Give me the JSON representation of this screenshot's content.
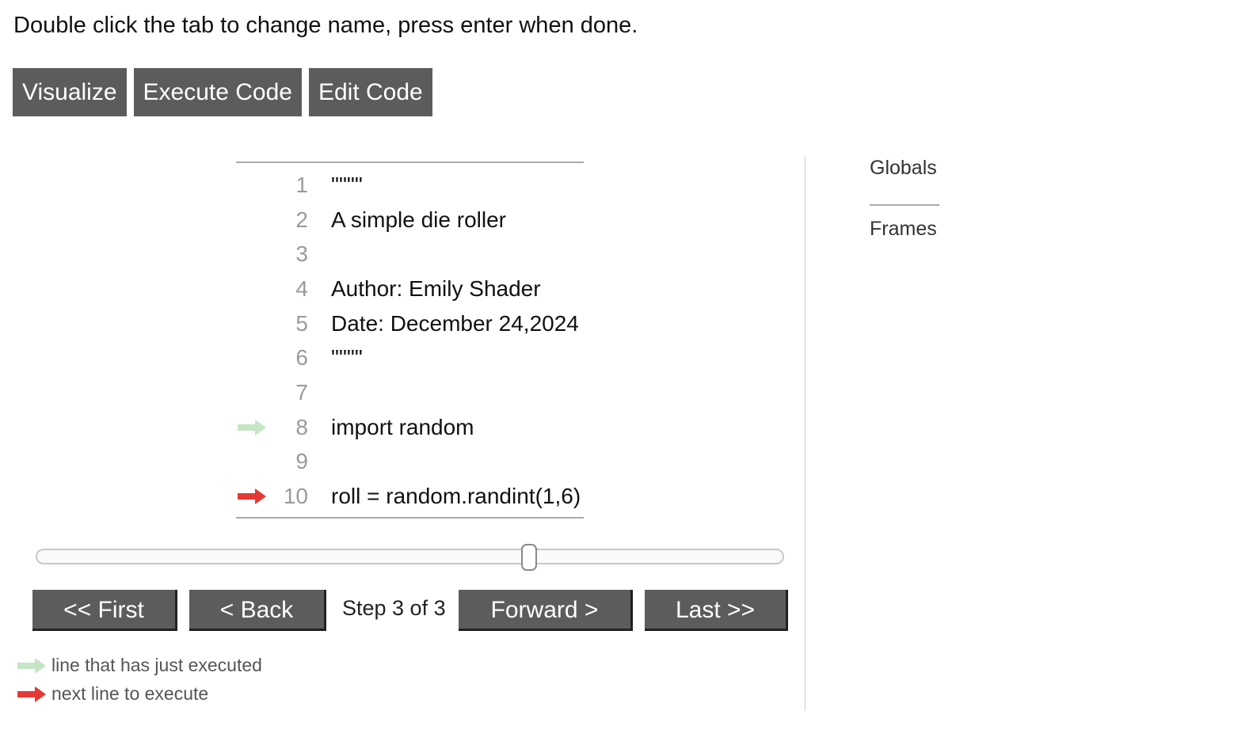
{
  "instructions": "Double click the tab to change name, press enter when done.",
  "mode_buttons": [
    {
      "label": "Visualize"
    },
    {
      "label": "Execute Code"
    },
    {
      "label": "Edit Code"
    }
  ],
  "code": {
    "lines": [
      {
        "num": "1",
        "text": "\"\"\"\""
      },
      {
        "num": "2",
        "text": "A simple die roller"
      },
      {
        "num": "3",
        "text": ""
      },
      {
        "num": "4",
        "text": "Author: Emily Shader"
      },
      {
        "num": "5",
        "text": "Date: December 24,2024"
      },
      {
        "num": "6",
        "text": "\"\"\"\""
      },
      {
        "num": "7",
        "text": ""
      },
      {
        "num": "8",
        "text": "import random",
        "arrow": "just-executed"
      },
      {
        "num": "9",
        "text": ""
      },
      {
        "num": "10",
        "text": "roll = random.randint(1,6)",
        "arrow": "next"
      }
    ]
  },
  "slider": {
    "step": 3,
    "total": 3,
    "position_fraction": 0.66
  },
  "navigation": {
    "first_label": "<< First",
    "back_label": "< Back",
    "step_text": "Step 3 of 3",
    "forward_label": "Forward >",
    "last_label": "Last >>"
  },
  "legend": {
    "just_executed": "line that has just executed",
    "next_line": "next line to execute"
  },
  "right_panel": {
    "globals_label": "Globals",
    "frames_label": "Frames"
  },
  "colors": {
    "button_bg": "#5c5c5c",
    "just_executed_arrow": "#c5e5c5",
    "next_arrow": "#e53935"
  }
}
